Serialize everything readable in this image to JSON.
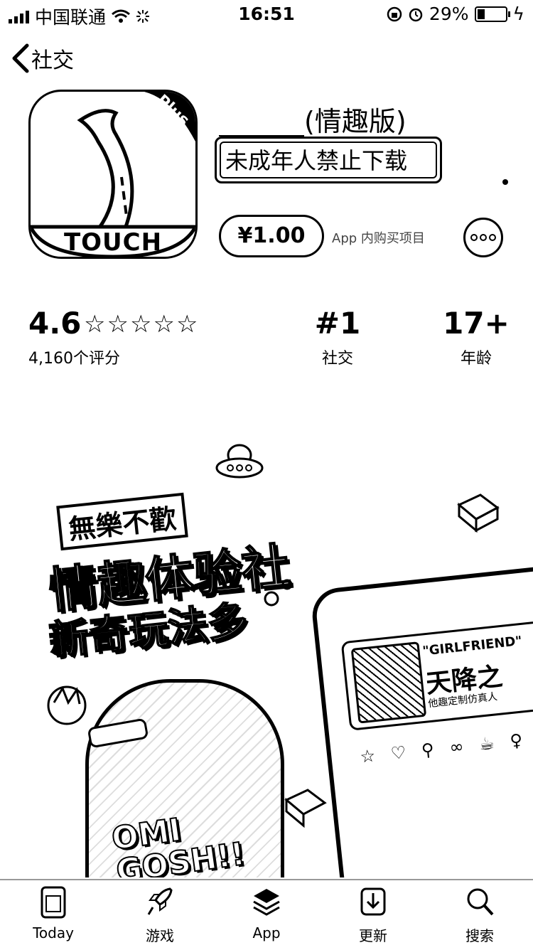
{
  "status_bar": {
    "carrier": "中国联通",
    "time": "16:51",
    "battery": "29%"
  },
  "nav": {
    "back_label": "社交"
  },
  "app": {
    "icon_text": "TOUCH",
    "icon_badge": "Plus",
    "title": "(情趣版)",
    "subtitle": "未成年人禁止下载",
    "price": "¥1.00",
    "in_app_purchase": "App 内购买项目"
  },
  "stats": {
    "rating": "4.6",
    "rating_count": "4,160个评分",
    "rank": "#1",
    "rank_category": "社交",
    "age": "17+",
    "age_label": "年龄"
  },
  "screenshot": {
    "tag": "無樂不歡",
    "headline1": "情趣体验社",
    "headline2": "新奇玩法多",
    "exclaim1": "OMI",
    "exclaim2": "GOSH!!",
    "phone_title": "\"GIRLFRIEND\"",
    "phone_cn": "天降之",
    "phone_sub": "他趣定制仿真人"
  },
  "tab_bar": {
    "tabs": [
      {
        "label": "Today",
        "icon": "today-icon"
      },
      {
        "label": "游戏",
        "icon": "rocket-icon"
      },
      {
        "label": "App",
        "icon": "layers-icon"
      },
      {
        "label": "更新",
        "icon": "download-icon"
      },
      {
        "label": "搜索",
        "icon": "search-icon"
      }
    ]
  }
}
